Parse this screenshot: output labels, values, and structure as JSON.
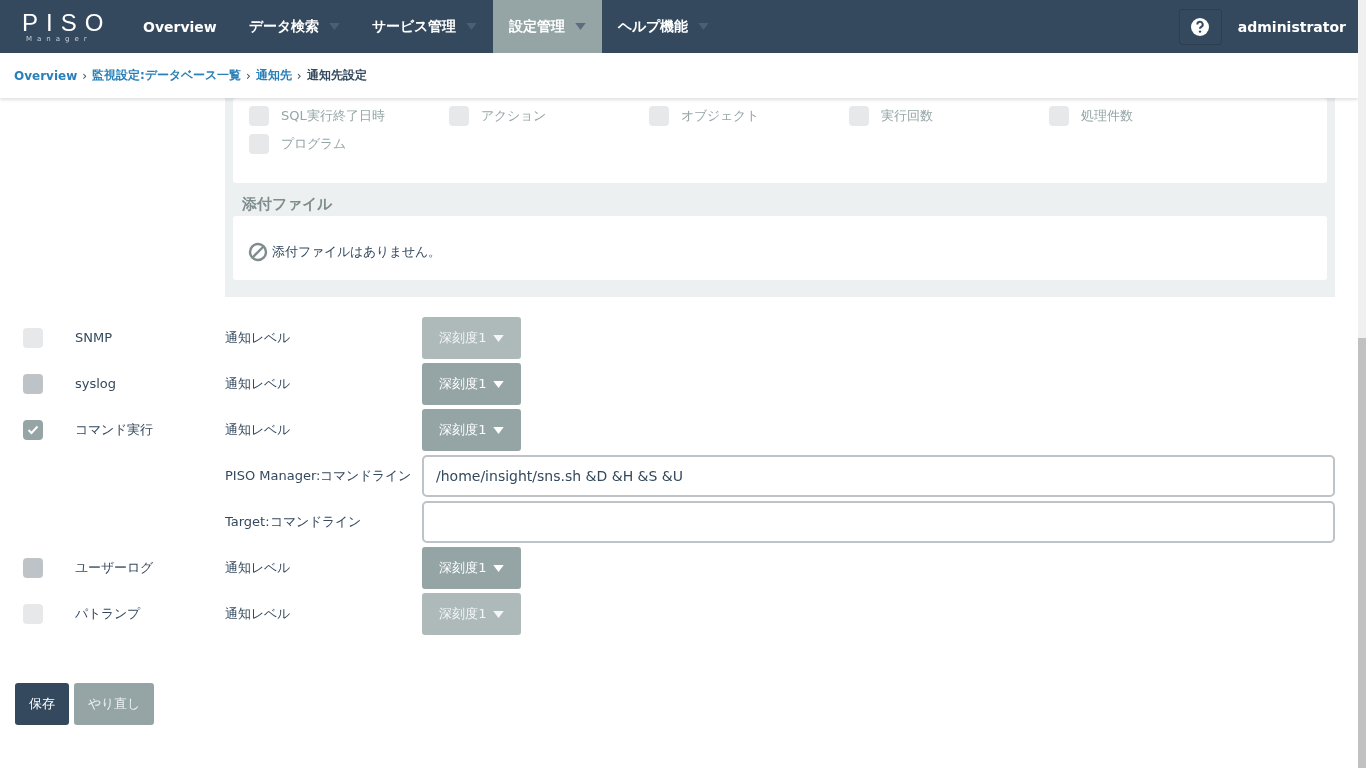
{
  "header": {
    "logo": "PISO",
    "logo_sub": "Manager",
    "nav": [
      {
        "label": "Overview",
        "has_menu": false,
        "selected": false
      },
      {
        "label": "データ検索",
        "has_menu": true,
        "selected": false
      },
      {
        "label": "サービス管理",
        "has_menu": true,
        "selected": false
      },
      {
        "label": "設定管理",
        "has_menu": true,
        "selected": true
      },
      {
        "label": "ヘルプ機能",
        "has_menu": true,
        "selected": false
      }
    ],
    "user": "administrator"
  },
  "breadcrumb": {
    "separator": "›",
    "items": [
      {
        "label": "Overview",
        "link": true
      },
      {
        "label": "監視設定:データベース一覧",
        "link": true
      },
      {
        "label": "通知先",
        "link": true
      },
      {
        "label": "通知先設定",
        "link": false
      }
    ]
  },
  "fields_grid": [
    {
      "label": "SQL実行終了日時",
      "checked": false
    },
    {
      "label": "アクション",
      "checked": false
    },
    {
      "label": "オブジェクト",
      "checked": false
    },
    {
      "label": "実行回数",
      "checked": false
    },
    {
      "label": "処理件数",
      "checked": false
    },
    {
      "label": "プログラム",
      "checked": false
    }
  ],
  "attachments": {
    "title": "添付ファイル",
    "empty_text": "添付ファイルはありません。"
  },
  "notifications": [
    {
      "kind": "level",
      "name": "SNMP",
      "checked": false,
      "disabled": true,
      "field_label": "通知レベル",
      "value": "深刻度1"
    },
    {
      "kind": "level",
      "name": "syslog",
      "checked": false,
      "disabled": false,
      "field_label": "通知レベル",
      "value": "深刻度1"
    },
    {
      "kind": "level",
      "name": "コマンド実行",
      "checked": true,
      "disabled": false,
      "field_label": "通知レベル",
      "value": "深刻度1"
    },
    {
      "kind": "input",
      "field_label": "PISO Manager:コマンドライン",
      "value": "/home/insight/sns.sh &D &H &S &U"
    },
    {
      "kind": "input",
      "field_label": "Target:コマンドライン"
    },
    {
      "kind": "level",
      "name": "ユーザーログ",
      "checked": false,
      "disabled": false,
      "field_label": "通知レベル",
      "value": "深刻度1"
    },
    {
      "kind": "level",
      "name": "パトランプ",
      "checked": false,
      "disabled": true,
      "field_label": "通知レベル",
      "value": "深刻度1"
    }
  ],
  "buttons": [
    {
      "label": "保存",
      "kind": "primary"
    },
    {
      "label": "やり直し",
      "kind": "secondary"
    }
  ]
}
